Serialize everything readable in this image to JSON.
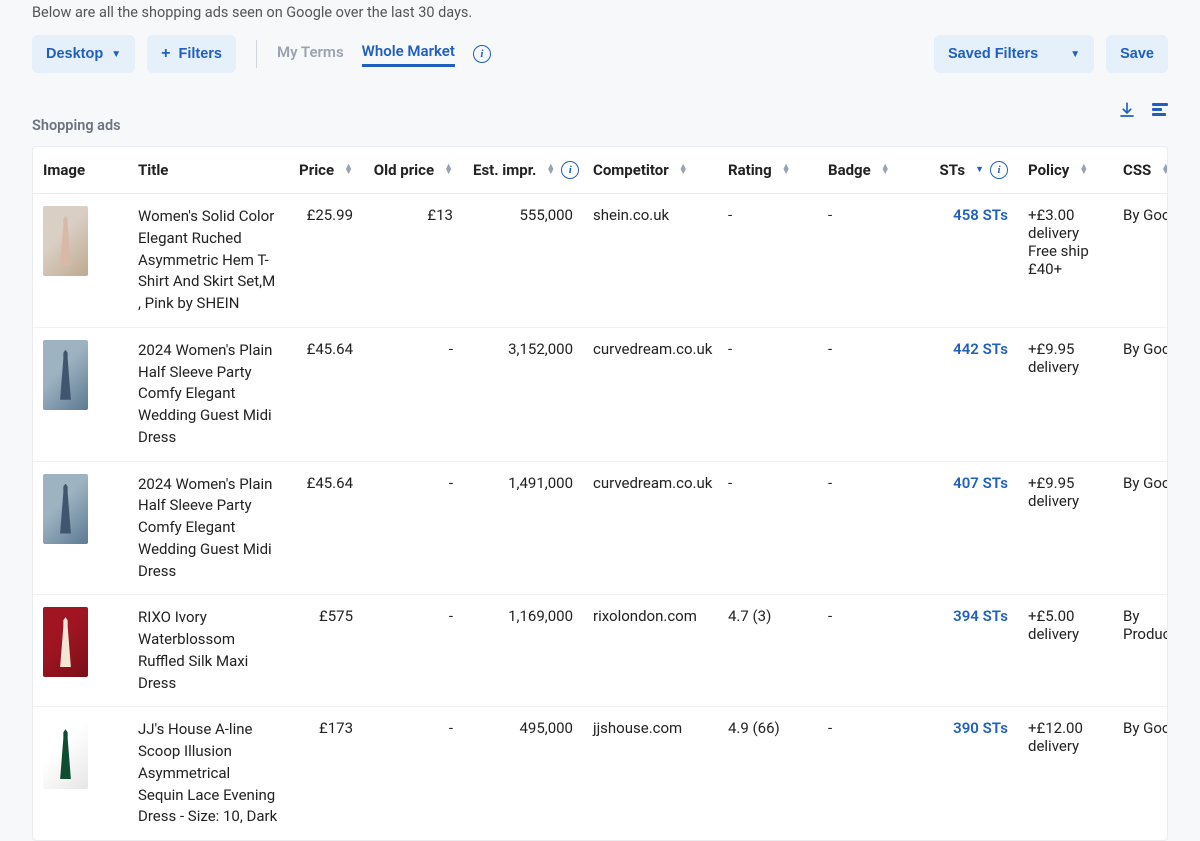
{
  "intro": "Below are all the shopping ads seen on Google over the last 30 days.",
  "toolbar": {
    "device_label": "Desktop",
    "filters_label": "Filters",
    "my_terms_label": "My Terms",
    "whole_market_label": "Whole Market",
    "saved_filters_label": "Saved Filters",
    "save_label": "Save"
  },
  "section_title": "Shopping ads",
  "columns": {
    "image": "Image",
    "title": "Title",
    "price": "Price",
    "old_price": "Old price",
    "est_impr": "Est. impr.",
    "competitor": "Competitor",
    "rating": "Rating",
    "badge": "Badge",
    "sts": "STs",
    "policy": "Policy",
    "css": "CSS"
  },
  "rows": [
    {
      "title": "Women's Solid Color Elegant Ruched Asymmetric Hem T-Shirt And Skirt Set,M , Pink by SHEIN",
      "price": "£25.99",
      "old_price": "£13",
      "est_impr": "555,000",
      "competitor": "shein.co.uk",
      "rating": "-",
      "badge": "-",
      "sts": "458 STs",
      "policy": "+£3.00 delivery Free ship £40+",
      "css": "By Google",
      "thumb_c1": "#d9cfc5",
      "thumb_c2": "#bfa98f",
      "thumb_s": "#d8b9a8"
    },
    {
      "title": "2024 Women's Plain Half Sleeve Party Comfy Elegant Wedding Guest Midi Dress",
      "price": "£45.64",
      "old_price": "-",
      "est_impr": "3,152,000",
      "competitor": "curvedream.co.uk",
      "rating": "-",
      "badge": "-",
      "sts": "442 STs",
      "policy": "+£9.95 delivery",
      "css": "By Google",
      "thumb_c1": "#9db3c2",
      "thumb_c2": "#5d7a93",
      "thumb_s": "#3f566e"
    },
    {
      "title": "2024 Women's Plain Half Sleeve Party Comfy Elegant Wedding Guest Midi Dress",
      "price": "£45.64",
      "old_price": "-",
      "est_impr": "1,491,000",
      "competitor": "curvedream.co.uk",
      "rating": "-",
      "badge": "-",
      "sts": "407 STs",
      "policy": "+£9.95 delivery",
      "css": "By Google",
      "thumb_c1": "#9db3c2",
      "thumb_c2": "#5d7a93",
      "thumb_s": "#3f566e"
    },
    {
      "title": "RIXO Ivory Waterblossom Ruffled Silk Maxi Dress",
      "price": "£575",
      "old_price": "-",
      "est_impr": "1,169,000",
      "competitor": "rixolondon.com",
      "rating": "4.7 (3)",
      "badge": "-",
      "sts": "394 STs",
      "policy": "+£5.00 delivery",
      "css": "By Producthero",
      "thumb_c1": "#a11522",
      "thumb_c2": "#7a0e18",
      "thumb_s": "#f3e6d4"
    },
    {
      "title": "JJ's House A-line Scoop Illusion Asymmetrical Sequin Lace Evening Dress - Size: 10, Dark",
      "price": "£173",
      "old_price": "-",
      "est_impr": "495,000",
      "competitor": "jjshouse.com",
      "rating": "4.9 (66)",
      "badge": "-",
      "sts": "390 STs",
      "policy": "+£12.00 delivery",
      "css": "By Google",
      "thumb_c1": "#ffffff",
      "thumb_c2": "#e6e6e6",
      "thumb_s": "#0f4d33"
    }
  ]
}
